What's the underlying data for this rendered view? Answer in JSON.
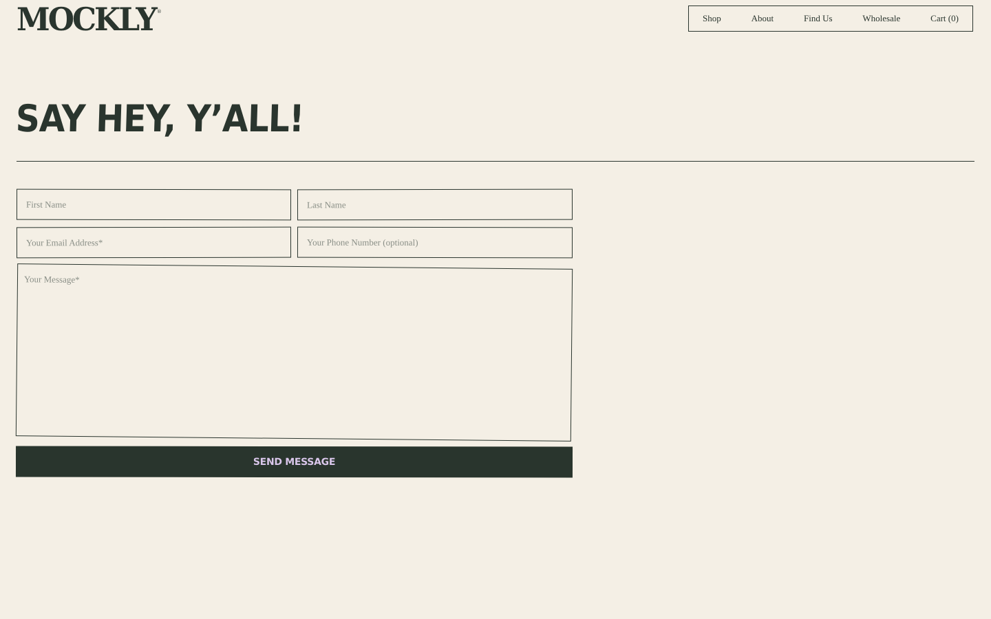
{
  "brand": {
    "name": "MOCKLY",
    "registered_mark": "®"
  },
  "nav": {
    "items": [
      {
        "label": "Shop"
      },
      {
        "label": "About"
      },
      {
        "label": "Find Us"
      },
      {
        "label": "Wholesale"
      },
      {
        "label": "Cart (0)"
      }
    ]
  },
  "page": {
    "title": "SAY HEY, Y’ALL!"
  },
  "form": {
    "first_name": {
      "value": "",
      "placeholder": "First Name"
    },
    "last_name": {
      "value": "",
      "placeholder": "Last Name"
    },
    "email": {
      "value": "",
      "placeholder": "Your Email Address*"
    },
    "phone": {
      "value": "",
      "placeholder": "Your Phone Number (optional)"
    },
    "message": {
      "value": "",
      "placeholder": "Your Message*"
    },
    "submit_label": "Send Message"
  },
  "colors": {
    "background": "#f4efe5",
    "ink": "#2a352e",
    "button_bg": "#29352d",
    "button_text": "#d9c6ea",
    "placeholder": "#8a8f87"
  }
}
